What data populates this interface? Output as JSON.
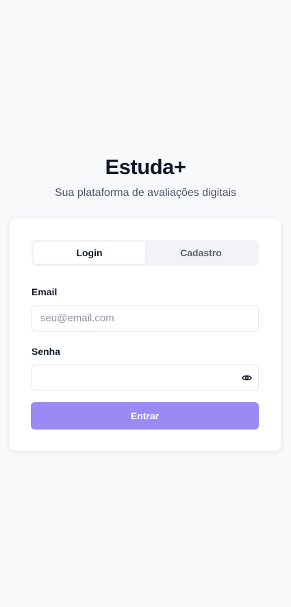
{
  "app": {
    "title": "Estuda+",
    "tagline": "Sua plataforma de avaliações digitais"
  },
  "auth": {
    "tabs": [
      {
        "label": "Login",
        "active": true
      },
      {
        "label": "Cadastro",
        "active": false
      }
    ],
    "email": {
      "label": "Email",
      "placeholder": "seu@email.com",
      "value": ""
    },
    "password": {
      "label": "Senha",
      "placeholder": "",
      "value": "",
      "toggle_icon": "eye-icon"
    },
    "submit_label": "Entrar",
    "colors": {
      "accent": "#9b8af3",
      "background": "#f8f9fb",
      "card": "#ffffff"
    }
  }
}
